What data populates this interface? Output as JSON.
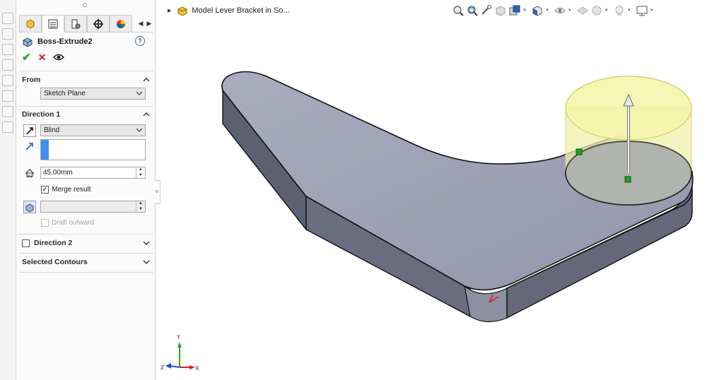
{
  "panel": {
    "feature_title": "Boss-Extrude2",
    "help_label": "?",
    "tabs": [
      "feature-manager-icon",
      "property-manager-icon",
      "configuration-manager-icon",
      "dim-xpert-icon",
      "display-manager-icon"
    ],
    "from": {
      "header": "From",
      "value": "Sketch Plane"
    },
    "direction1": {
      "header": "Direction 1",
      "end_condition": "Blind",
      "depth": "45.00mm",
      "merge_result_label": "Merge result",
      "merge_result_checked": true,
      "draft_outward_label": "Draft outward",
      "draft_outward_checked": false
    },
    "direction2": {
      "header": "Direction 2",
      "checked": false
    },
    "selected_contours": {
      "header": "Selected Contours"
    }
  },
  "viewport": {
    "document_title": "Model Lever Bracket in So...",
    "triad": {
      "x": "X",
      "y": "Y",
      "z": "Z"
    }
  },
  "colors": {
    "accent_blue": "#3d8ff0",
    "part_top": "#9da0b5",
    "part_side": "#5f6173",
    "preview_yellow": "#f3f3b0"
  }
}
